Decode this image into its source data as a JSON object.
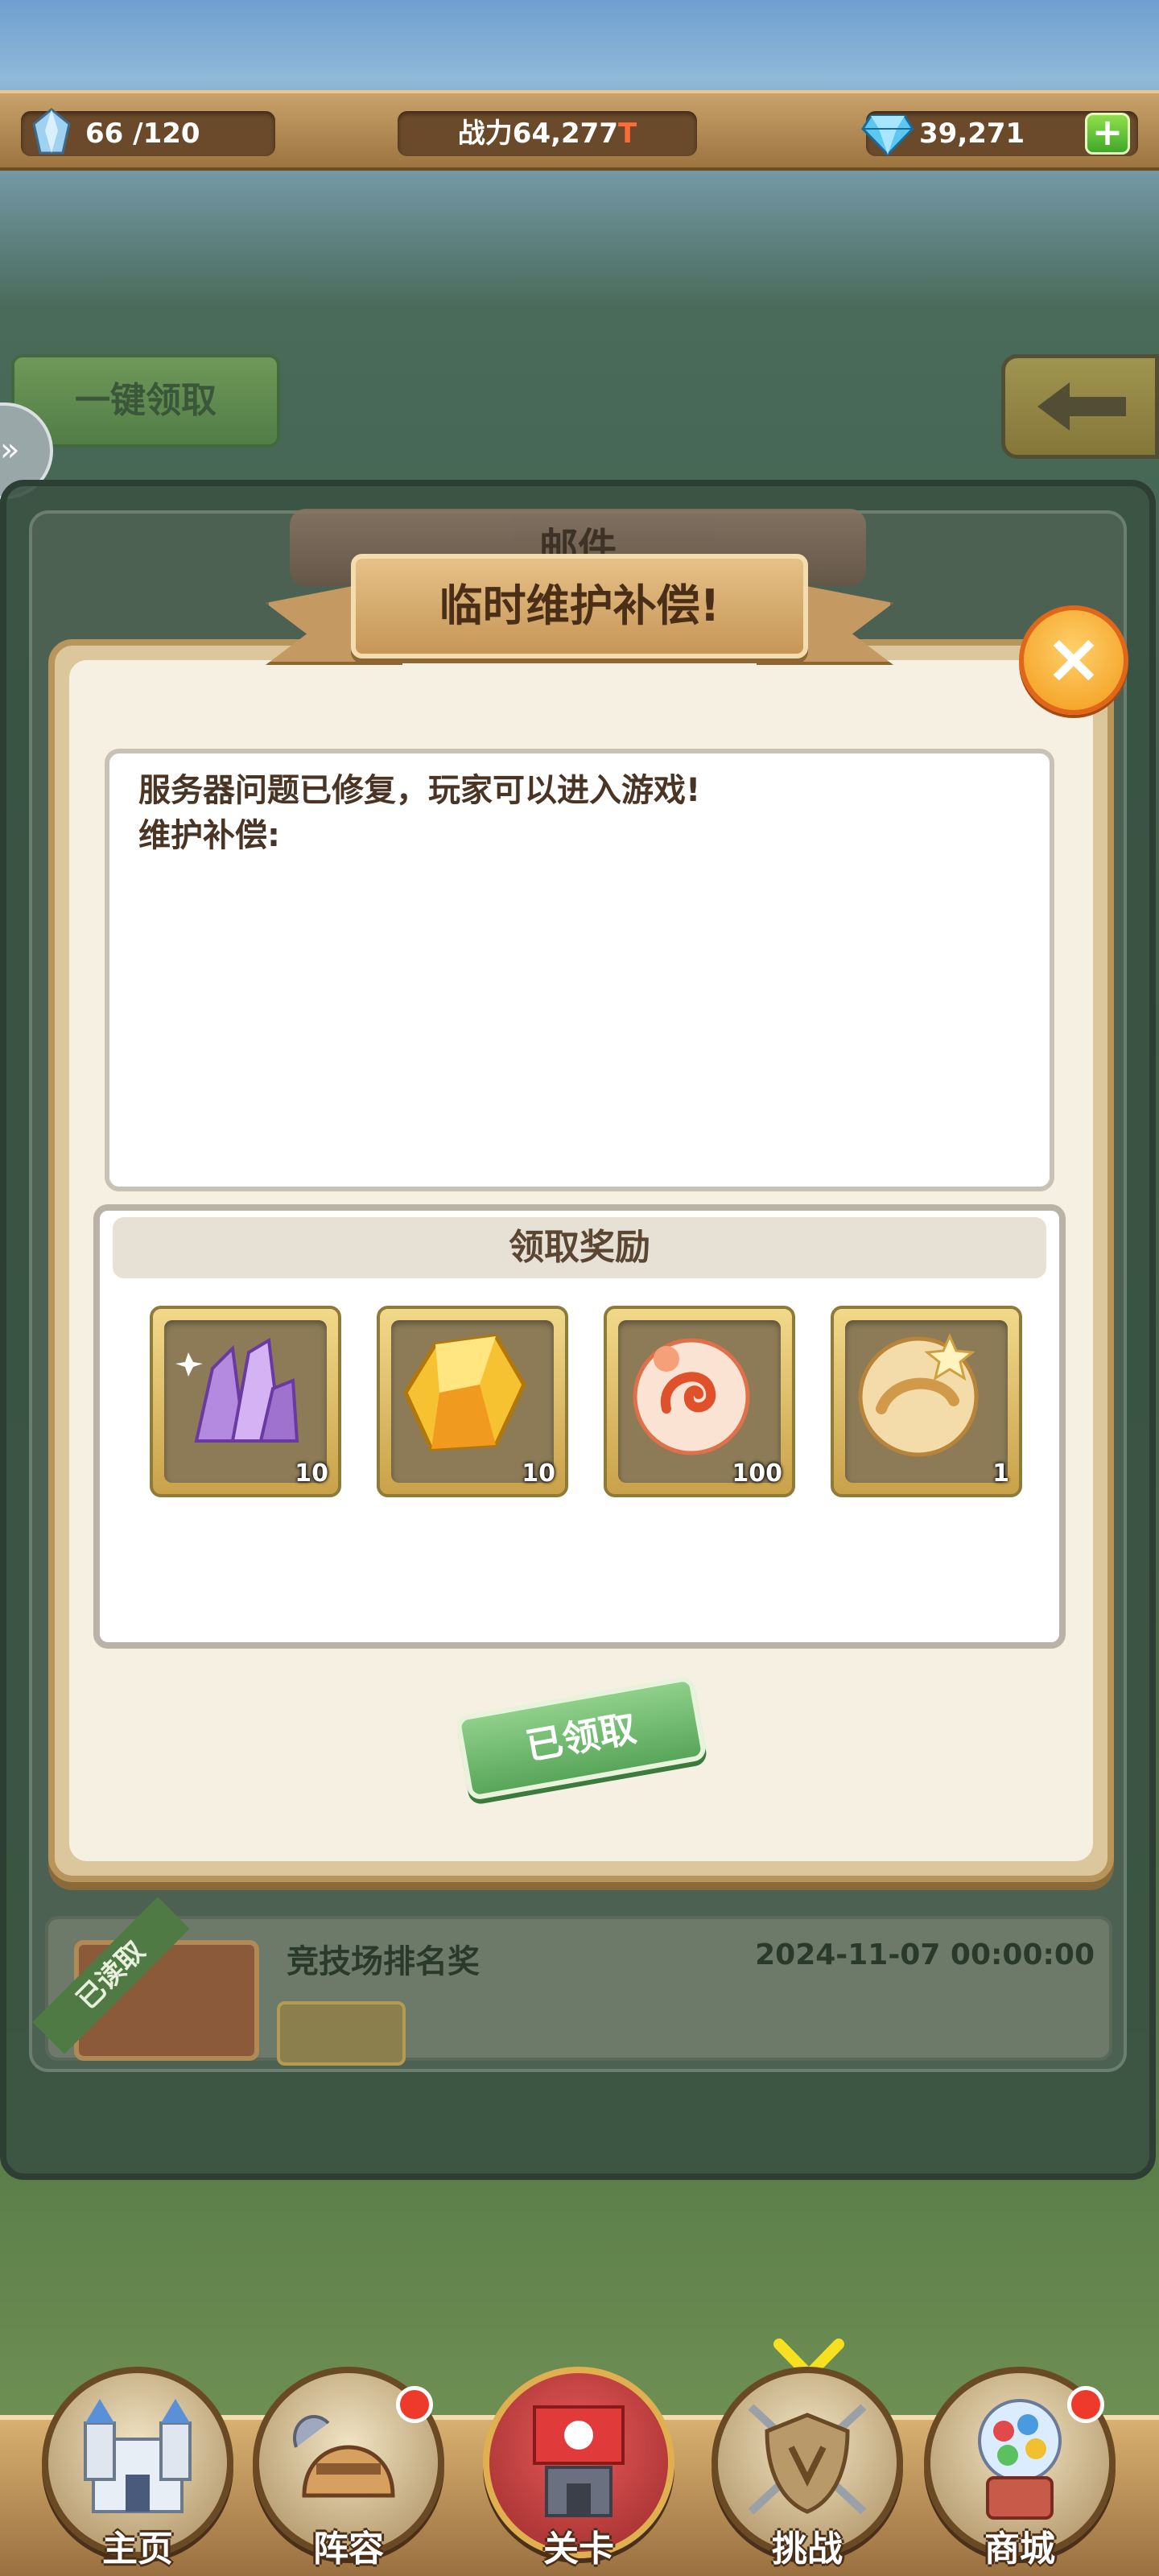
{
  "status": {
    "energy": "66 /120",
    "power_label": "战力",
    "power_value": "64,277",
    "power_suffix": "T",
    "gems": "39,271",
    "plus": "+"
  },
  "background": {
    "claim_all_label": "一键领取",
    "mail_title": "邮件",
    "mail_item": {
      "read_label": "已读取",
      "title": "竞技场排名奖",
      "date": "2024-11-07 00:00:00"
    }
  },
  "popup": {
    "title": "临时维护补偿!",
    "close": "×",
    "message_line1": "服务器问题已修复，玩家可以进入游戏!",
    "message_line2": "维护补偿:",
    "reward_header": "领取奖励",
    "rewards": [
      {
        "name": "purple-crystal",
        "count": "10"
      },
      {
        "name": "gold-crystal",
        "count": "10"
      },
      {
        "name": "fire-orb",
        "count": "100"
      },
      {
        "name": "star-orb",
        "count": "1"
      }
    ],
    "claimed_label": "已领取"
  },
  "nav": [
    {
      "label": "主页",
      "icon": "castle-icon"
    },
    {
      "label": "阵容",
      "icon": "helmet-icon"
    },
    {
      "label": "关卡",
      "icon": "battle-flag-icon"
    },
    {
      "label": "挑战",
      "icon": "shield-swords-icon"
    },
    {
      "label": "商城",
      "icon": "gumball-machine-icon"
    }
  ],
  "colors": {
    "accent_green": "#58a65a",
    "close_orange": "#f29a1a",
    "frame_tan": "#dcc79c",
    "notification_red": "#ee3a2a"
  }
}
